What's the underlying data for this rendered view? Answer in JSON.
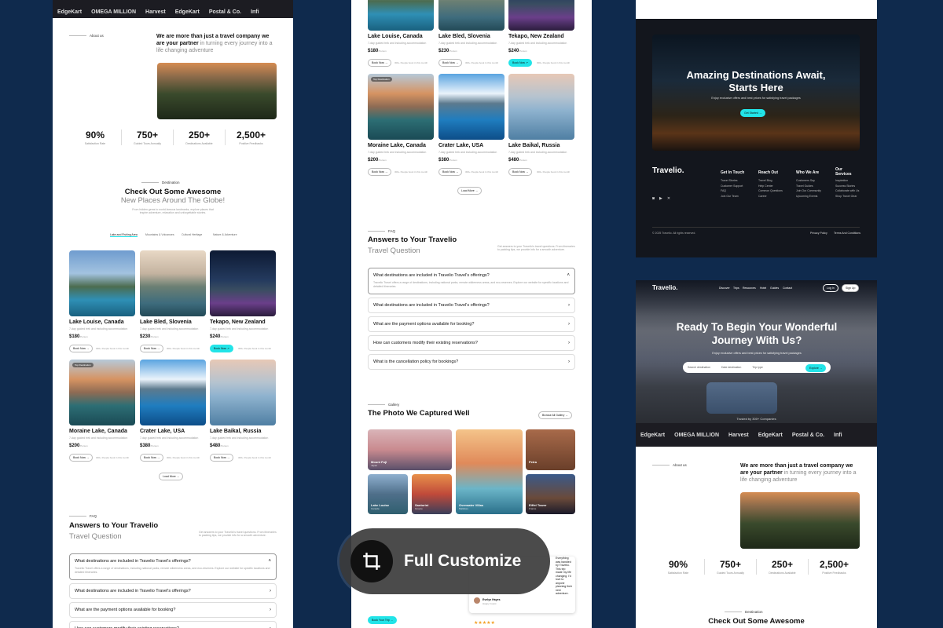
{
  "logos": [
    "EdgeKart",
    "OMEGA MILLION",
    "Harvest",
    "EdgeKart",
    "Postal & Co.",
    "Infi"
  ],
  "about": {
    "label": "About us",
    "headline_bold": "We are more than just a travel company we are your partner",
    "headline_rest": " in turning every journey into a life changing adventure"
  },
  "stats": [
    {
      "value": "90%",
      "label": "Satisfaction Rate"
    },
    {
      "value": "750+",
      "label": "Guided Tours Annually"
    },
    {
      "value": "250+",
      "label": "Destinations Available"
    },
    {
      "value": "2,500+",
      "label": "Positive Feedbacks"
    }
  ],
  "destination": {
    "label": "Destination",
    "title": "Check Out Some Awesome",
    "subtitle": "New Places Around The Globe!",
    "desc": "From hidden gems to world-famous landmarks, explore places that inspire adventure, relaxation and unforgettable stories.",
    "tabs": [
      "Lake and Fishing Area",
      "Mountains & Volcanoes",
      "Cultural Heritage",
      "Nature & Adventure"
    ]
  },
  "cards": [
    {
      "title": "Lake Louise, Canada",
      "price": "$180",
      "per": "/Person",
      "btn": "Book Now",
      "note": "300+ People book in this month",
      "badge": ""
    },
    {
      "title": "Lake Bled, Slovenia",
      "price": "$230",
      "per": "/Person",
      "btn": "Book Now",
      "note": "300+ People book in this month",
      "badge": ""
    },
    {
      "title": "Tekapo, New Zealand",
      "price": "$240",
      "per": "/Person",
      "btn": "Book Now",
      "note": "300+ People book in this month",
      "badge": ""
    },
    {
      "title": "Moraine Lake, Canada",
      "price": "$200",
      "per": "/Person",
      "btn": "Book Now",
      "note": "300+ People book in this month",
      "badge": "Top Destination"
    },
    {
      "title": "Crater Lake, USA",
      "price": "$380",
      "per": "/Person",
      "btn": "Book Now",
      "note": "300+ People book in this month",
      "badge": ""
    },
    {
      "title": "Lake Baikal, Russia",
      "price": "$480",
      "per": "/Person",
      "btn": "Book Now",
      "note": "300+ People book in this month",
      "badge": ""
    }
  ],
  "card_desc": "7-day guided trek and including accommodation",
  "load_more": "Load More",
  "faq": {
    "label": "FAQ",
    "title": "Answers to Your Travelio",
    "subtitle": "Travel Question",
    "side": "Get answers to your Travelio's travel questions. From itineraries to packing tips, we provide info for a smooth adventure.",
    "items": [
      {
        "q": "What destinations are included in Travelio Travel's offerings?",
        "a": "Travelio Travel offers a range of destinations, including national parks, remote wilderness areas, and eco-reserves. Explore our website for specific locations and detailed itineraries."
      },
      {
        "q": "What destinations are included in Travelio Travel's offerings?",
        "a": ""
      },
      {
        "q": "What are the payment options available for booking?",
        "a": ""
      },
      {
        "q": "How can customers modify their existing reservations?",
        "a": ""
      },
      {
        "q": "What is the cancellation policy for bookings?",
        "a": ""
      }
    ]
  },
  "gallery": {
    "label": "Gallery",
    "title": "The Photo We Captured Well",
    "btn": "Browse All Gallery",
    "items": [
      {
        "name": "Mount Fuji",
        "loc": "Japan"
      },
      {
        "name": "Lake Louise",
        "loc": "Canada"
      },
      {
        "name": "Santorini",
        "loc": "Greece"
      },
      {
        "name": "Overwater Villas",
        "loc": "Maldives"
      },
      {
        "name": "Petra",
        "loc": "Jordan"
      },
      {
        "name": "Eiffel Tower",
        "loc": "France"
      }
    ]
  },
  "testimonial": {
    "quote": "Everything was handled by Travelio. This trip made my life changing. I'd love to anyone planning their next adventure.",
    "name": "Evelyn Hayes",
    "role": "Happy Guest",
    "stars": "★★★★★",
    "btn": "Book Your Trip"
  },
  "customize": "Full Customize",
  "cta": {
    "title": "Amazing Destinations Await, Starts Here",
    "sub": "Enjoy exclusive offers and best prices for satisfying travel packages",
    "btn": "Get Started"
  },
  "brand": "Travelio.",
  "footer": {
    "cols": [
      {
        "head": "Get In Touch",
        "links": [
          "Travel Stories",
          "Customer Support",
          "FAQ",
          "Join Our Team"
        ]
      },
      {
        "head": "Reach Out",
        "links": [
          "Travel Blog",
          "Help Center",
          "Common Questions",
          "Career"
        ]
      },
      {
        "head": "Who We Are",
        "links": [
          "Customers Say",
          "Travel Guides",
          "Join Our Community",
          "Upcoming Events"
        ]
      },
      {
        "head": "Our Services",
        "links": [
          "Inspiration",
          "Success Stories",
          "Collaborate with Us",
          "Shop Travel Gear"
        ]
      }
    ],
    "copy": "© 2025 Travelio. All rights reserved.",
    "privacy": "Privacy Policy",
    "terms": "Terms And Conditions"
  },
  "nav": {
    "links": [
      "Discover",
      "Trips",
      "Resources",
      "Hotel",
      "Guides",
      "Contact"
    ],
    "login": "Log In",
    "signup": "Sign Up"
  },
  "hero": {
    "title": "Ready To Begin Your Wonderful Journey With Us?",
    "sub": "Enjoy exclusive offers and best prices for satisfying travel packages",
    "search": [
      "Search destination",
      "Date destination",
      "Trip type"
    ],
    "btn": "Explore",
    "trusted": "Trusted by 300+ Companies"
  },
  "colors": {
    "accent": "#22e4e8",
    "bg": "#0f2a4d"
  }
}
